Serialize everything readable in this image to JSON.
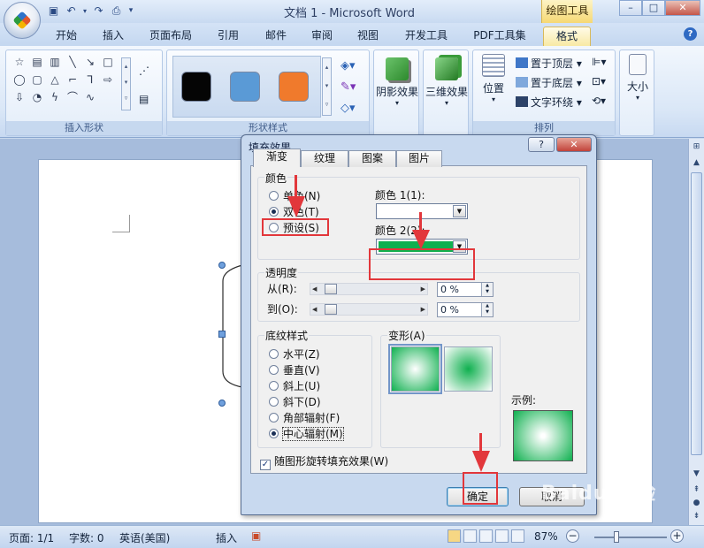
{
  "app": {
    "window_title": "文档 1 - Microsoft Word",
    "context_tab_header": "绘图工具"
  },
  "ribbon": {
    "tabs": [
      "开始",
      "插入",
      "页面布局",
      "引用",
      "邮件",
      "审阅",
      "视图",
      "开发工具",
      "PDF工具集",
      "格式"
    ],
    "active_tab": "格式",
    "groups": {
      "insert_shapes": "插入形状",
      "shape_styles": "形状样式",
      "shadow_effects": "阴影效果",
      "three_d_effects": "三维效果",
      "arrange": "排列",
      "size": "大小"
    },
    "style_swatches": [
      "#050505",
      "#5a9ad6",
      "#f07a2c"
    ],
    "arrange_buttons": {
      "position": "位置",
      "bring_to_front": "置于顶层",
      "send_to_back": "置于底层",
      "text_wrap": "文字环绕"
    },
    "size_button": "大小"
  },
  "dialog": {
    "title": "填充效果",
    "help": "?",
    "close": "✕",
    "tabs": [
      "渐变",
      "纹理",
      "图案",
      "图片"
    ],
    "active_tab": "渐变",
    "colors": {
      "section": "颜色",
      "options": [
        "单色(N)",
        "双色(T)",
        "预设(S)"
      ],
      "selected": "双色(T)",
      "color1_label": "颜色 1(1):",
      "color1_value": "#ffffff",
      "color2_label": "颜色 2(2):",
      "color2_value": "#0fb04f"
    },
    "transparency": {
      "section": "透明度",
      "from_label": "从(R):",
      "from_value": "0 %",
      "to_label": "到(O):",
      "to_value": "0 %"
    },
    "shading_styles": {
      "section": "底纹样式",
      "options": [
        "水平(Z)",
        "垂直(V)",
        "斜上(U)",
        "斜下(D)",
        "角部辐射(F)",
        "中心辐射(M)"
      ],
      "selected": "中心辐射(M)"
    },
    "variants": {
      "section": "变形(A)"
    },
    "sample_label": "示例:",
    "rotate_checkbox": "随图形旋转填充效果(W)",
    "rotate_checked": true,
    "ok": "确定",
    "cancel": "取消"
  },
  "statusbar": {
    "page": "页面: 1/1",
    "words": "字数: 0",
    "language": "英语(美国)",
    "mode": "插入",
    "zoom": "87%"
  },
  "watermark": "Baidu 经验",
  "annotation_color": "#e2373b"
}
